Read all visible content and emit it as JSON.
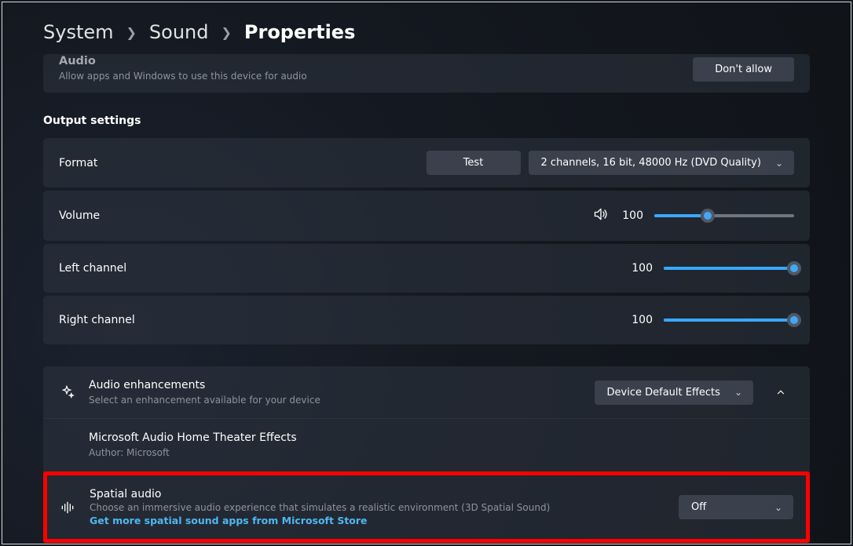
{
  "breadcrumb": {
    "l0": "System",
    "l1": "Sound",
    "l2": "Properties"
  },
  "general_card": {
    "title": "Audio",
    "subtitle": "Allow apps and Windows to use this device for audio",
    "button": "Don't allow"
  },
  "output_section_title": "Output settings",
  "format_row": {
    "label": "Format",
    "test_btn": "Test",
    "dropdown_value": "2 channels, 16 bit, 48000 Hz (DVD Quality)"
  },
  "volume_row": {
    "label": "Volume",
    "value": "100"
  },
  "left_row": {
    "label": "Left channel",
    "value": "100"
  },
  "right_row": {
    "label": "Right channel",
    "value": "100"
  },
  "enhance_row": {
    "title": "Audio enhancements",
    "subtitle": "Select an enhancement available for your device",
    "dropdown_value": "Device Default Effects"
  },
  "enhance_item": {
    "title": "Microsoft Audio Home Theater Effects",
    "author": "Author: Microsoft"
  },
  "spatial_row": {
    "title": "Spatial audio",
    "subtitle": "Choose an immersive audio experience that simulates a realistic environment (3D Spatial Sound)",
    "link": "Get more spatial sound apps from Microsoft Store",
    "dropdown_value": "Off"
  }
}
